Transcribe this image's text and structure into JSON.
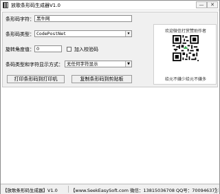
{
  "window": {
    "title": "放歌条形码生成器V1.0",
    "minimize_glyph": "—",
    "close_glyph": "✕"
  },
  "form": {
    "barcode_text_label": "条形码字符：",
    "barcode_text_value": "黑牛网",
    "barcode_type_label": "条形码类型：",
    "barcode_type_value": "CodePostNet",
    "rotation_label": "旋转角度值：",
    "rotation_value": "0",
    "checksum_label": "加入校验码",
    "checksum_checked": false,
    "text_display_label": "条码类型和字符显示方式：",
    "text_display_value": "无任何字符显示",
    "select_arrow_glyph": "▼"
  },
  "buttons": {
    "print_label": "打印条形码到打印机",
    "copy_label": "复制条形码到剪贴板"
  },
  "qr_panel": {
    "caption_top": "欢迎微信打赏赞助作者",
    "caption_bottom": "给元不嫌少给元不嫌多"
  },
  "statusbar": {
    "app_name": "【放歌条形码生成器】V1.0",
    "contact": "【www.SeekEasySoft.com 微信：13815036708 QQ号：70094637】"
  },
  "colors": {
    "panel_bg": "#f0f0f0",
    "window_border": "#8a8a8a"
  }
}
